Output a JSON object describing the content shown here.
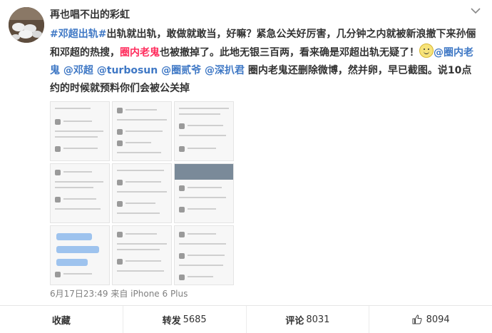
{
  "post": {
    "username": "再也唱不出的彩虹",
    "segments": [
      {
        "text": "#邓超出轨#",
        "type": "hashtag"
      },
      {
        "text": "出轨就出轨，敢做就敢当，好嘛？紧急公关好厉害，几分钟之内就被新浪撤下来孙俪和邓超的热搜，",
        "type": "plain"
      },
      {
        "text": "圈内老鬼",
        "type": "highlight"
      },
      {
        "text": "也被撤掉了。此地无银三百两，看来确是邓超出轨无疑了！",
        "type": "plain"
      },
      {
        "text": "@圈内老鬼",
        "type": "mention"
      },
      {
        "text": " ",
        "type": "plain"
      },
      {
        "text": "@邓超",
        "type": "mention"
      },
      {
        "text": " ",
        "type": "plain"
      },
      {
        "text": "@turbosun",
        "type": "mention"
      },
      {
        "text": " ",
        "type": "plain"
      },
      {
        "text": "@圈贰爷",
        "type": "mention"
      },
      {
        "text": " ",
        "type": "plain"
      },
      {
        "text": "@深扒君",
        "type": "mention"
      },
      {
        "text": " 圈内老鬼还删除微博，然并卵，早已截图。说10点约的时候就预料你们会被公关掉",
        "type": "plain"
      }
    ],
    "time": "6月17日23:49",
    "source_label": "来自",
    "source": "iPhone 6 Plus"
  },
  "actions": {
    "favorite": {
      "label": "收藏"
    },
    "repost": {
      "label": "转发",
      "count": "5685"
    },
    "comment": {
      "label": "评论",
      "count": "8031"
    },
    "like": {
      "count": "8094"
    }
  },
  "colors": {
    "link": "#3f78c5",
    "highlight": "#ff2e5e",
    "meta": "#808080"
  },
  "icons": {
    "more": "chevron-down-icon",
    "like": "thumbs-up-icon",
    "emoji": "smile-emoji-icon"
  }
}
